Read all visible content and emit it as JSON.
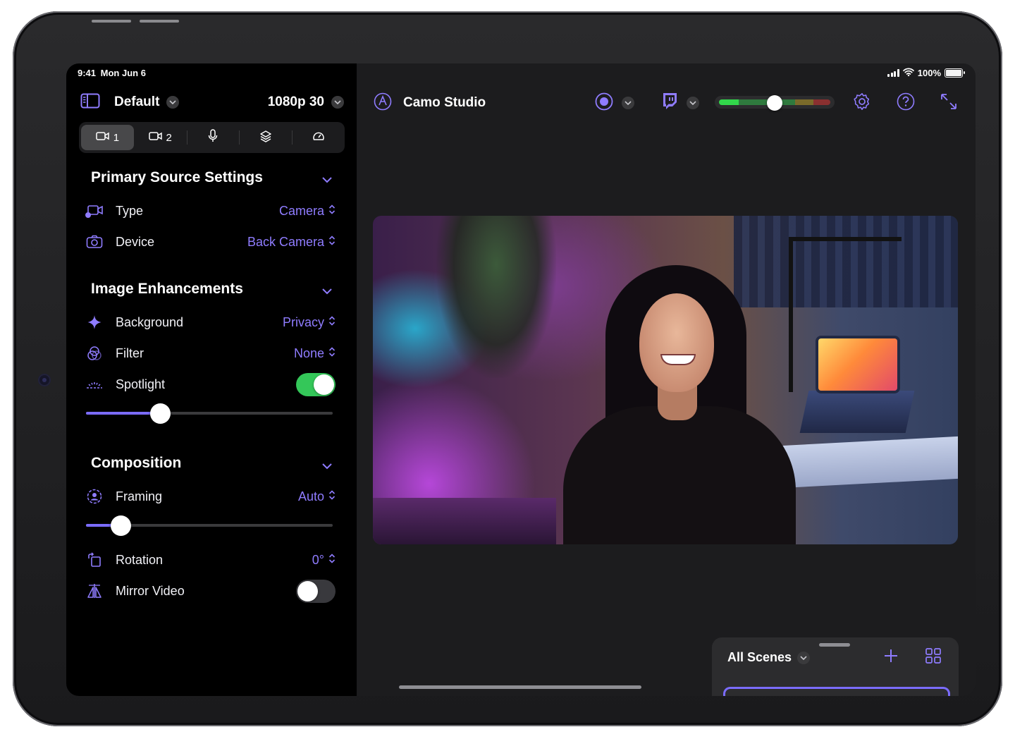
{
  "status_bar": {
    "time": "9:41",
    "date": "Mon Jun 6",
    "battery": "100%"
  },
  "sidebar": {
    "profile": "Default",
    "resolution": "1080p 30",
    "tabs": [
      {
        "icon": "video-camera-icon",
        "label": "1",
        "selected": true
      },
      {
        "icon": "video-camera-icon",
        "label": "2",
        "selected": false
      },
      {
        "icon": "microphone-icon",
        "label": "",
        "selected": false
      },
      {
        "icon": "layers-icon",
        "label": "",
        "selected": false
      },
      {
        "icon": "gauge-icon",
        "label": "",
        "selected": false
      }
    ],
    "primary": {
      "title": "Primary Source Settings",
      "type_label": "Type",
      "type_value": "Camera",
      "device_label": "Device",
      "device_value": "Back Camera"
    },
    "enhancements": {
      "title": "Image Enhancements",
      "background_label": "Background",
      "background_value": "Privacy",
      "filter_label": "Filter",
      "filter_value": "None",
      "spotlight_label": "Spotlight",
      "spotlight_on": true,
      "spotlight_level": 0.3
    },
    "composition": {
      "title": "Composition",
      "framing_label": "Framing",
      "framing_value": "Auto",
      "framing_level": 0.14,
      "rotation_label": "Rotation",
      "rotation_value": "0°",
      "mirror_label": "Mirror Video",
      "mirror_on": false
    }
  },
  "toolbar": {
    "app_title": "Camo Studio",
    "audio_level": 0.5
  },
  "scenes": {
    "title": "All Scenes"
  },
  "colors": {
    "accent": "#7b6cff",
    "toggle_on": "#34c759",
    "sidebar_bg": "#000000",
    "main_bg": "#1c1c1e"
  }
}
